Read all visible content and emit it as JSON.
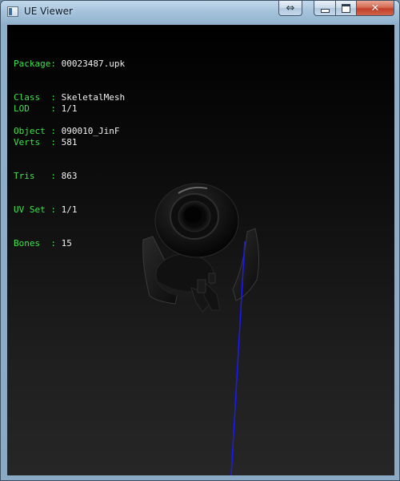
{
  "window": {
    "title": "UE Viewer",
    "buttons": {
      "extra_icon": "double-arrow-icon",
      "minimize_icon": "minimize-icon",
      "maximize_icon": "maximize-icon",
      "close_icon": "close-icon"
    }
  },
  "info": {
    "group1": [
      {
        "label": "Package: ",
        "value": "00023487.upk"
      },
      {
        "label": "Class  : ",
        "value": "SkeletalMesh"
      },
      {
        "label": "Object : ",
        "value": "090010_JinF"
      }
    ],
    "group2": [
      {
        "label": "LOD    : ",
        "value": "1/1"
      },
      {
        "label": "Verts  : ",
        "value": "581"
      },
      {
        "label": "Tris   : ",
        "value": "863"
      },
      {
        "label": "UV Set : ",
        "value": "1/1"
      },
      {
        "label": "Bones  : ",
        "value": "15"
      }
    ]
  },
  "colors": {
    "label_green": "#3ee34a",
    "value_white": "#f2f2f2",
    "axis_blue": "#1a1aff"
  }
}
